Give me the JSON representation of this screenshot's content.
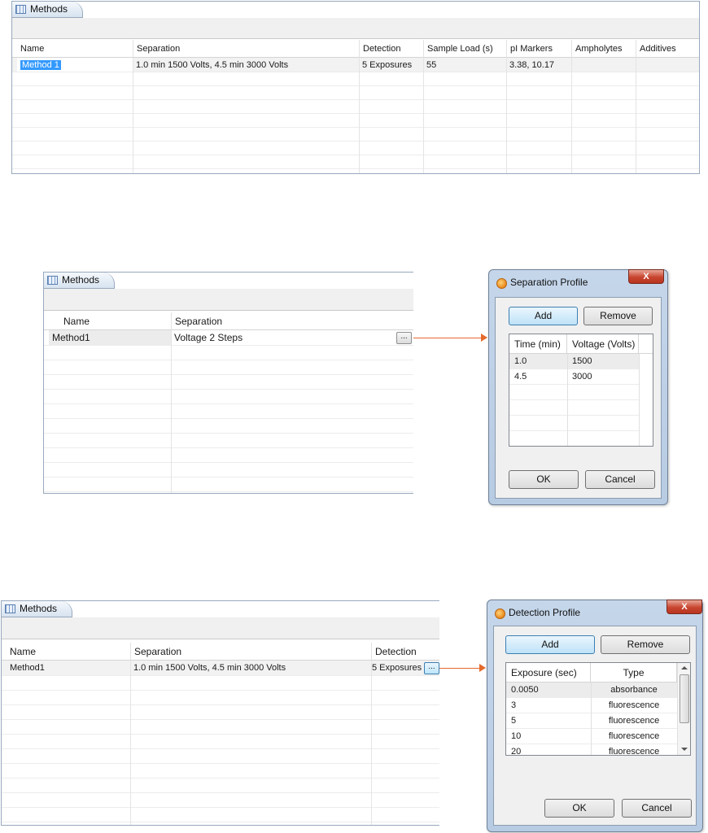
{
  "panel1": {
    "tab_label": "Methods",
    "columns": [
      "Name",
      "Separation",
      "Detection",
      "Sample Load (s)",
      "pI Markers",
      "Ampholytes",
      "Additives"
    ],
    "row": {
      "name": "Method 1",
      "separation": "1.0 min 1500 Volts, 4.5 min 3000 Volts",
      "detection": "5 Exposures",
      "sample_load": "55",
      "pi_markers": "3.38, 10.17",
      "ampholytes": "",
      "additives": ""
    }
  },
  "panel2": {
    "tab_label": "Methods",
    "columns": [
      "Name",
      "Separation"
    ],
    "row": {
      "name": "Method1",
      "separation": "Voltage 2 Steps"
    },
    "ellipsis": "..."
  },
  "separation_dialog": {
    "title": "Separation Profile",
    "close_label": "X",
    "add_label": "Add",
    "remove_label": "Remove",
    "columns": [
      "Time (min)",
      "Voltage (Volts)"
    ],
    "rows": [
      {
        "time": "1.0",
        "voltage": "1500"
      },
      {
        "time": "4.5",
        "voltage": "3000"
      }
    ],
    "ok_label": "OK",
    "cancel_label": "Cancel"
  },
  "panel3": {
    "tab_label": "Methods",
    "columns": [
      "Name",
      "Separation",
      "Detection"
    ],
    "row": {
      "name": "Method1",
      "separation": "1.0 min 1500 Volts, 4.5 min 3000 Volts",
      "detection": "5 Exposures"
    },
    "ellipsis": "..."
  },
  "detection_dialog": {
    "title": "Detection Profile",
    "close_label": "X",
    "add_label": "Add",
    "remove_label": "Remove",
    "columns": [
      "Exposure (sec)",
      "Type"
    ],
    "rows": [
      {
        "exposure": "0.0050",
        "type": "absorbance"
      },
      {
        "exposure": "3",
        "type": "fluorescence"
      },
      {
        "exposure": "5",
        "type": "fluorescence"
      },
      {
        "exposure": "10",
        "type": "fluorescence"
      },
      {
        "exposure": "20",
        "type": "fluorescence"
      }
    ],
    "ok_label": "OK",
    "cancel_label": "Cancel"
  },
  "colors": {
    "selection": "#3399ff",
    "arrow": "#e46a2c",
    "dialog_frame": "#c5d6ea"
  },
  "icons": [
    "grid-icon",
    "app-icon",
    "close-icon",
    "ellipsis-icon",
    "arrow-icon",
    "scroll-up-icon",
    "scroll-down-icon"
  ]
}
